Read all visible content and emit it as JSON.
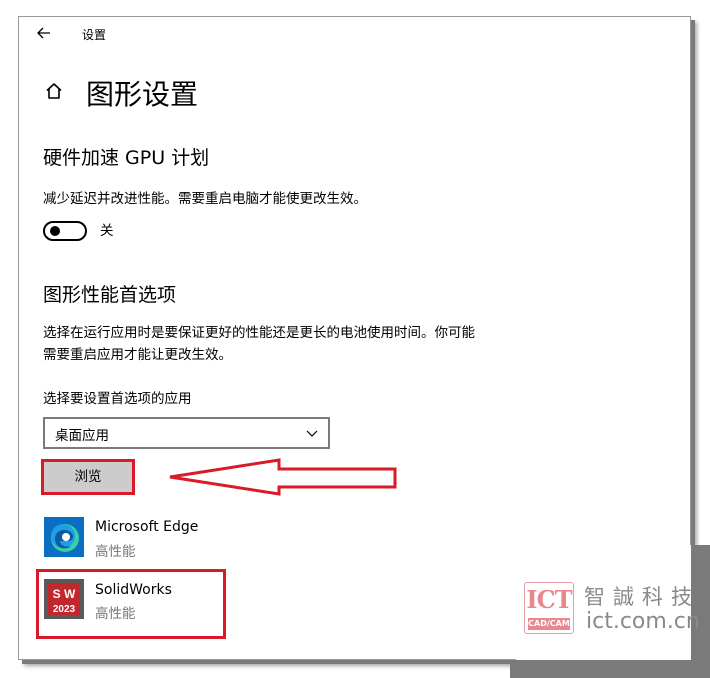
{
  "window": {
    "title": "设置",
    "page_title": "图形设置"
  },
  "gpu_scheduling": {
    "heading": "硬件加速 GPU 计划",
    "description": "减少延迟并改进性能。需要重启电脑才能使更改生效。",
    "toggle_state": "关"
  },
  "graphics_pref": {
    "heading": "图形性能首选项",
    "description_line1": "选择在运行应用时是要保证更好的性能还是更长的电池使用时间。你可能",
    "description_line2": "需要重启应用才能让更改生效。",
    "select_label": "选择要设置首选项的应用",
    "select_value": "桌面应用",
    "browse_label": "浏览"
  },
  "apps": [
    {
      "name": "Microsoft Edge",
      "preference": "高性能",
      "icon": "edge-icon"
    },
    {
      "name": "SolidWorks",
      "preference": "高性能",
      "icon": "solidworks-icon",
      "icon_text_top": "S W",
      "icon_text_bottom": "2023"
    }
  ],
  "watermark": {
    "logo": "ICT",
    "logo_sub": "CAD/CAM",
    "cn_name": "智誠科技",
    "url": "ict.com.cn"
  },
  "colors": {
    "highlight": "#d81b27",
    "secondary_text": "#767676",
    "watermark_pink": "#e8878e"
  }
}
